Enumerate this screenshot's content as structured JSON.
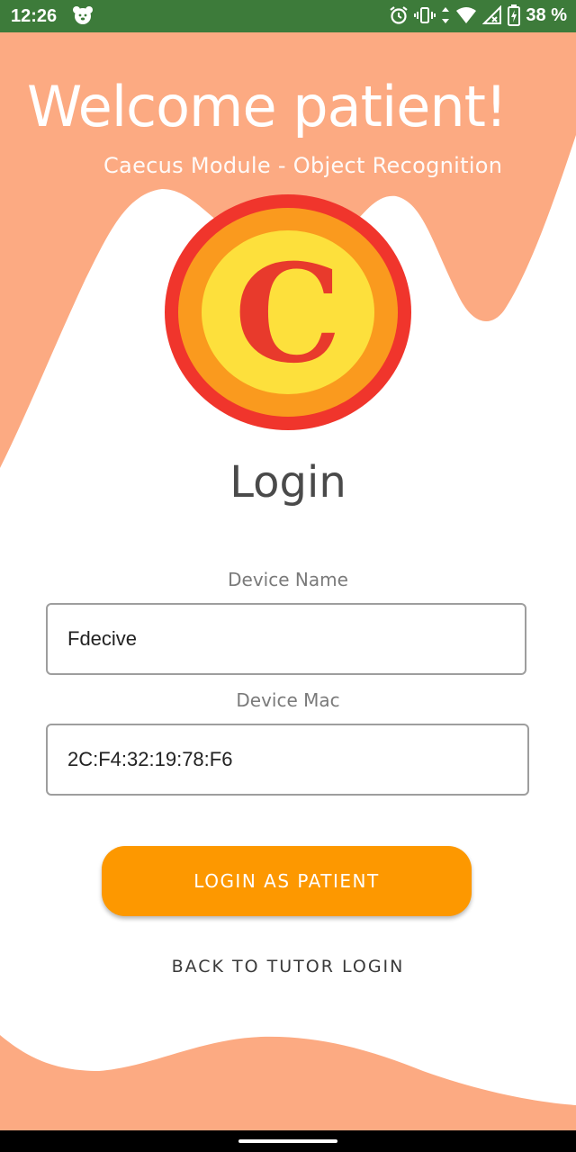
{
  "status_bar": {
    "time": "12:26",
    "battery": "38 %",
    "icons": [
      "bear-notification-icon",
      "alarm-icon",
      "vibrate-icon",
      "data-arrows-icon",
      "wifi-icon",
      "signal-icon",
      "battery-charging-icon"
    ],
    "color": "#3d7b3a"
  },
  "header": {
    "title": "Welcome patient!",
    "subtitle": "Caecus Module - Object Recognition"
  },
  "logo": {
    "letter": "C",
    "colors": {
      "outer_ring": "#f0352c",
      "middle_ring": "#fa9a1e",
      "inner_disc": "#fde03c",
      "letter": "#e83a2c"
    }
  },
  "form": {
    "heading": "Login",
    "device_name": {
      "label": "Device Name",
      "value": "Fdecive"
    },
    "device_mac": {
      "label": "Device Mac",
      "value": "2C:F4:32:19:78:F6"
    },
    "submit_label": "LOGIN AS PATIENT",
    "back_label": "BACK TO TUTOR LOGIN"
  },
  "theme": {
    "wave_color": "#fcaa82",
    "button_color": "#fd9800"
  }
}
